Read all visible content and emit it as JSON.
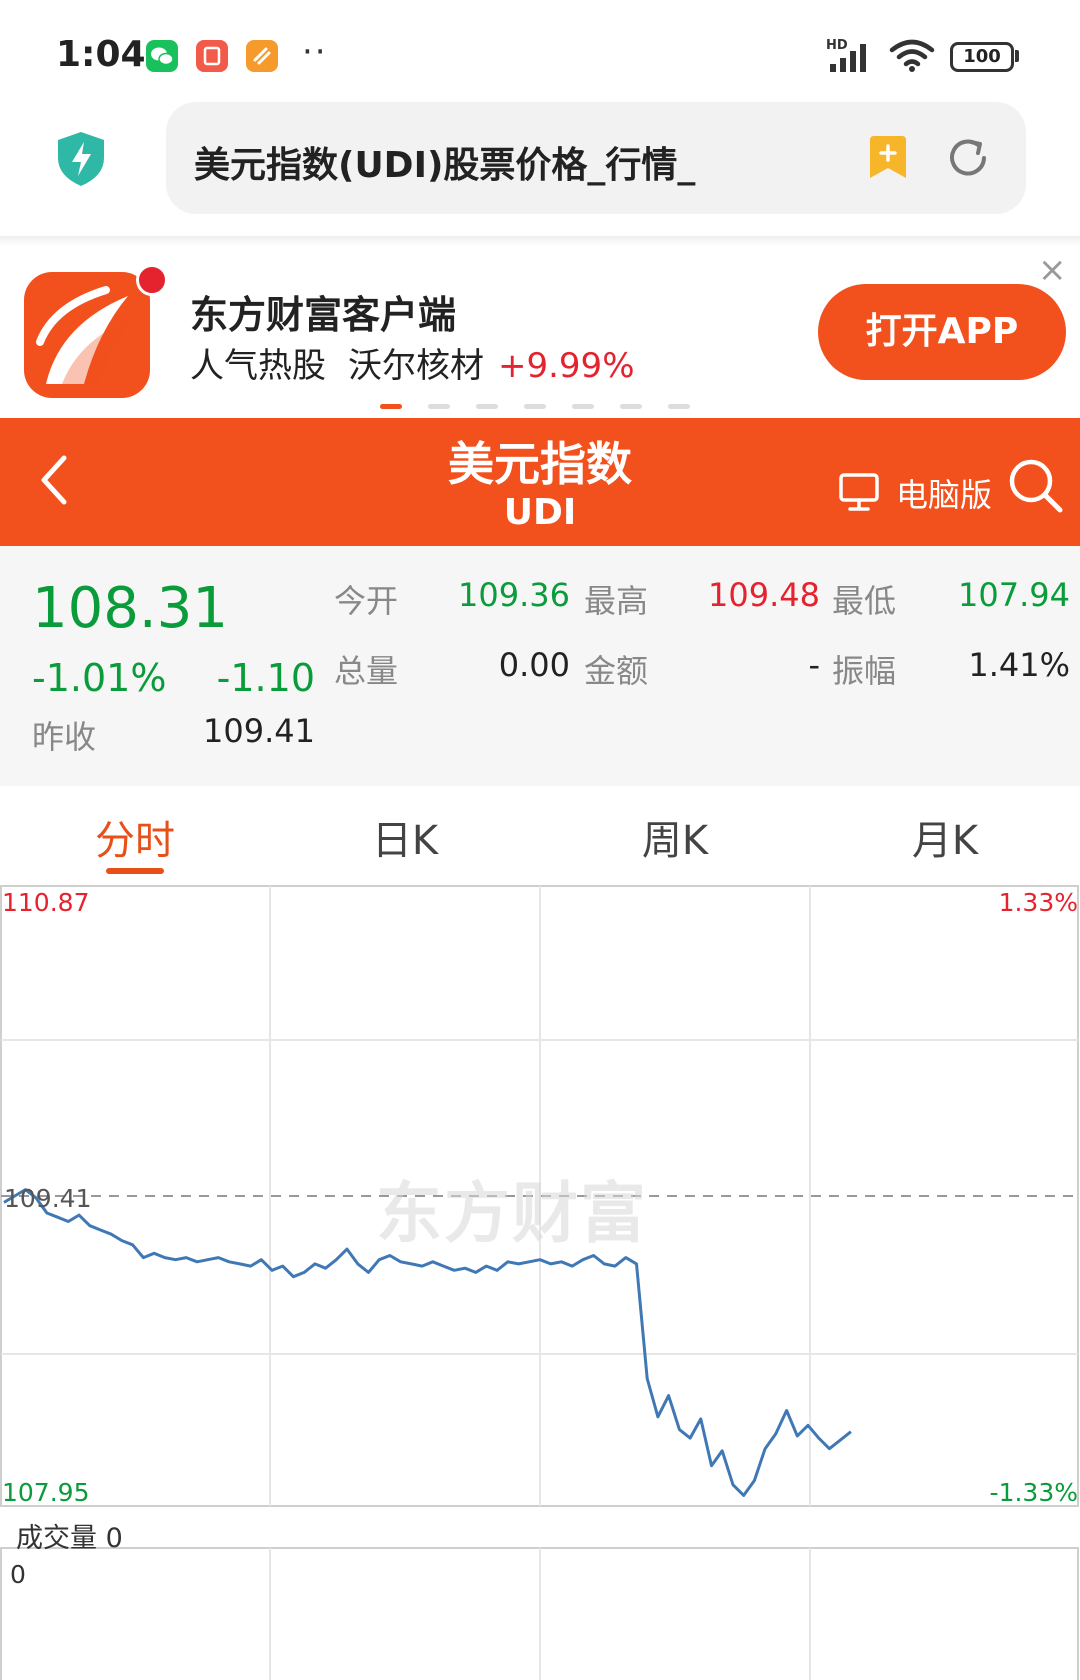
{
  "status_bar": {
    "time": "1:04",
    "more": "··",
    "network": "HD",
    "battery": "100",
    "app_icons": [
      {
        "name": "wechat-icon",
        "color": "#19c15d"
      },
      {
        "name": "red-app-icon",
        "color": "#f25a4a"
      },
      {
        "name": "orange-app-icon",
        "color": "#f59a2b"
      }
    ]
  },
  "browser": {
    "address_text": "美元指数(UDI)股票价格_行情_",
    "shield_icon": "shield-bolt-icon",
    "bookmark_icon": "bookmark-plus-icon",
    "reload_icon": "reload-icon"
  },
  "banner": {
    "app_name": "东方财富客户端",
    "hot_label": "人气热股",
    "stock_name": "沃尔核材",
    "stock_change": "+9.99%",
    "open_button": "打开APP",
    "close_icon": "×",
    "page_count": 7,
    "active_page": 0
  },
  "header": {
    "title": "美元指数",
    "code": "UDI",
    "pc_label": "电脑版",
    "back_icon": "back-arrow-icon",
    "search_icon": "search-icon"
  },
  "quote": {
    "price": "108.31",
    "change_pct": "-1.01%",
    "change": "-1.10",
    "prev_close_label": "昨收",
    "prev_close": "109.41",
    "stats": [
      {
        "label": "今开",
        "value": "109.36",
        "color": "green"
      },
      {
        "label": "最高",
        "value": "109.48",
        "color": "red"
      },
      {
        "label": "最低",
        "value": "107.94",
        "color": "green"
      },
      {
        "label": "总量",
        "value": "0.00",
        "color": "dark"
      },
      {
        "label": "金额",
        "value": "-",
        "color": "dark"
      },
      {
        "label": "振幅",
        "value": "1.41%",
        "color": "dark"
      }
    ]
  },
  "tabs": [
    {
      "label": "分时",
      "active": true
    },
    {
      "label": "日K",
      "active": false
    },
    {
      "label": "周K",
      "active": false
    },
    {
      "label": "月K",
      "active": false
    }
  ],
  "chart": {
    "top_price": "110.87",
    "bottom_price": "107.95",
    "top_pct": "1.33%",
    "bottom_pct": "-1.33%",
    "mid_price": "109.41",
    "watermark": "东方财富",
    "volume_label": "成交量 0",
    "volume_axis": "0"
  },
  "chart_data": {
    "type": "line",
    "ylim": [
      107.95,
      110.87
    ],
    "reference": 109.41,
    "x": [
      0,
      10,
      20,
      30,
      40,
      50,
      60,
      70,
      80,
      90,
      100,
      110,
      120,
      130,
      140,
      150,
      160,
      170,
      180,
      190,
      200,
      210,
      220,
      230,
      240,
      250,
      260,
      270,
      280,
      290,
      300,
      310,
      320,
      330,
      340,
      350,
      360,
      370,
      380,
      390,
      400,
      410,
      420,
      430,
      440,
      450,
      460,
      470,
      480,
      490,
      500,
      510,
      520,
      530,
      540,
      550,
      560,
      570,
      580,
      590,
      600,
      610,
      620,
      630,
      640,
      650,
      660,
      670,
      680,
      690,
      700,
      710,
      720,
      730,
      740,
      750,
      760,
      770,
      780,
      790
    ],
    "values": [
      109.38,
      109.41,
      109.44,
      109.4,
      109.33,
      109.31,
      109.29,
      109.32,
      109.27,
      109.25,
      109.23,
      109.2,
      109.18,
      109.12,
      109.14,
      109.12,
      109.11,
      109.12,
      109.1,
      109.11,
      109.12,
      109.1,
      109.09,
      109.08,
      109.11,
      109.06,
      109.08,
      109.03,
      109.05,
      109.09,
      109.07,
      109.11,
      109.16,
      109.09,
      109.05,
      109.11,
      109.13,
      109.1,
      109.09,
      109.08,
      109.1,
      109.08,
      109.06,
      109.07,
      109.05,
      109.08,
      109.06,
      109.1,
      109.09,
      109.1,
      109.11,
      109.09,
      109.1,
      109.08,
      109.11,
      109.13,
      109.09,
      109.08,
      109.12,
      109.09,
      108.55,
      108.37,
      108.47,
      108.31,
      108.27,
      108.36,
      108.14,
      108.21,
      108.05,
      108.0,
      108.07,
      108.22,
      108.29,
      108.4,
      108.28,
      108.33,
      108.27,
      108.22,
      108.26,
      108.3
    ]
  }
}
